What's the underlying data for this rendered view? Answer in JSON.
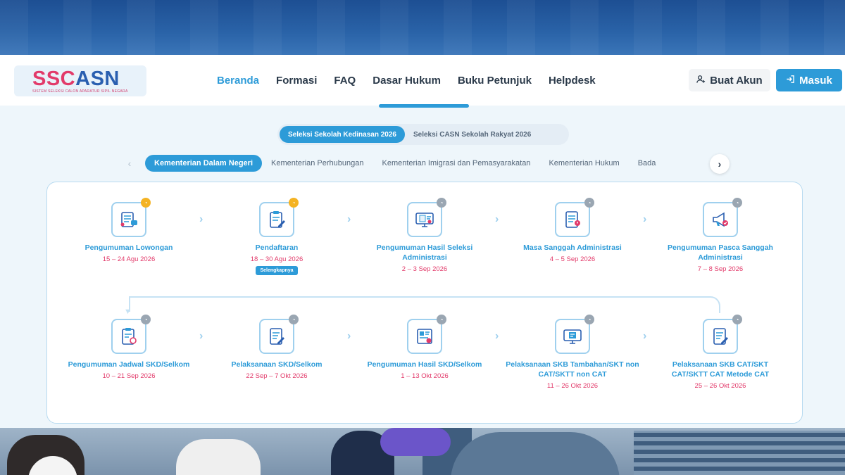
{
  "header": {
    "logo": {
      "word_a": "SSC",
      "word_b": "ASN",
      "tagline": "SISTEM SELEKSI CALON APARATUR SIPIL NEGARA"
    },
    "nav": [
      "Beranda",
      "Formasi",
      "FAQ",
      "Dasar Hukum",
      "Buku Petunjuk",
      "Helpdesk"
    ],
    "active_nav": "Beranda",
    "buat_akun": "Buat Akun",
    "masuk": "Masuk"
  },
  "seleksi_tabs": [
    "Seleksi Sekolah Kedinasan 2026",
    "Seleksi CASN Sekolah Rakyat 2026"
  ],
  "ministry_tabs": [
    "Kementerian Dalam Negeri",
    "Kementerian Perhubungan",
    "Kementerian Imigrasi dan Pemasyarakatan",
    "Kementerian Hukum",
    "Bada"
  ],
  "steps": [
    {
      "title": "Pengumuman Lowongan",
      "date": "15 – 24 Agu 2026",
      "status": "active"
    },
    {
      "title": "Pendaftaran",
      "date": "18 – 30 Agu 2026",
      "status": "active",
      "link": "Selengkapnya"
    },
    {
      "title": "Pengumuman Hasil Seleksi Administrasi",
      "date": "2 – 3 Sep 2026",
      "status": "pending"
    },
    {
      "title": "Masa Sanggah Administrasi",
      "date": "4 – 5 Sep 2026",
      "status": "pending"
    },
    {
      "title": "Pengumuman Pasca Sanggah Administrasi",
      "date": "7 – 8 Sep 2026",
      "status": "pending"
    },
    {
      "title": "Pengumuman Jadwal SKD/Selkom",
      "date": "10 – 21 Sep 2026",
      "status": "pending"
    },
    {
      "title": "Pelaksanaan SKD/Selkom",
      "date": "22 Sep – 7 Okt 2026",
      "status": "pending"
    },
    {
      "title": "Pengumuman Hasil SKD/Selkom",
      "date": "1 – 13 Okt 2026",
      "status": "pending"
    },
    {
      "title": "Pelaksanaan SKB Tambahan/SKT non CAT/SKTT non CAT",
      "date": "11 – 26 Okt 2026",
      "status": "pending"
    },
    {
      "title": "Pelaksanaan SKB CAT/SKT CAT/SKTT CAT Metode CAT",
      "date": "25 – 26 Okt 2026",
      "status": "pending"
    }
  ],
  "colors": {
    "accent": "#2d9bd8",
    "date": "#e23a6a",
    "badge_active": "#f4b323",
    "badge_pending": "#9aa6b2"
  },
  "icons": [
    "user-plus-icon",
    "login-icon",
    "chevron-left-icon",
    "chevron-right-icon",
    "clock-icon"
  ]
}
